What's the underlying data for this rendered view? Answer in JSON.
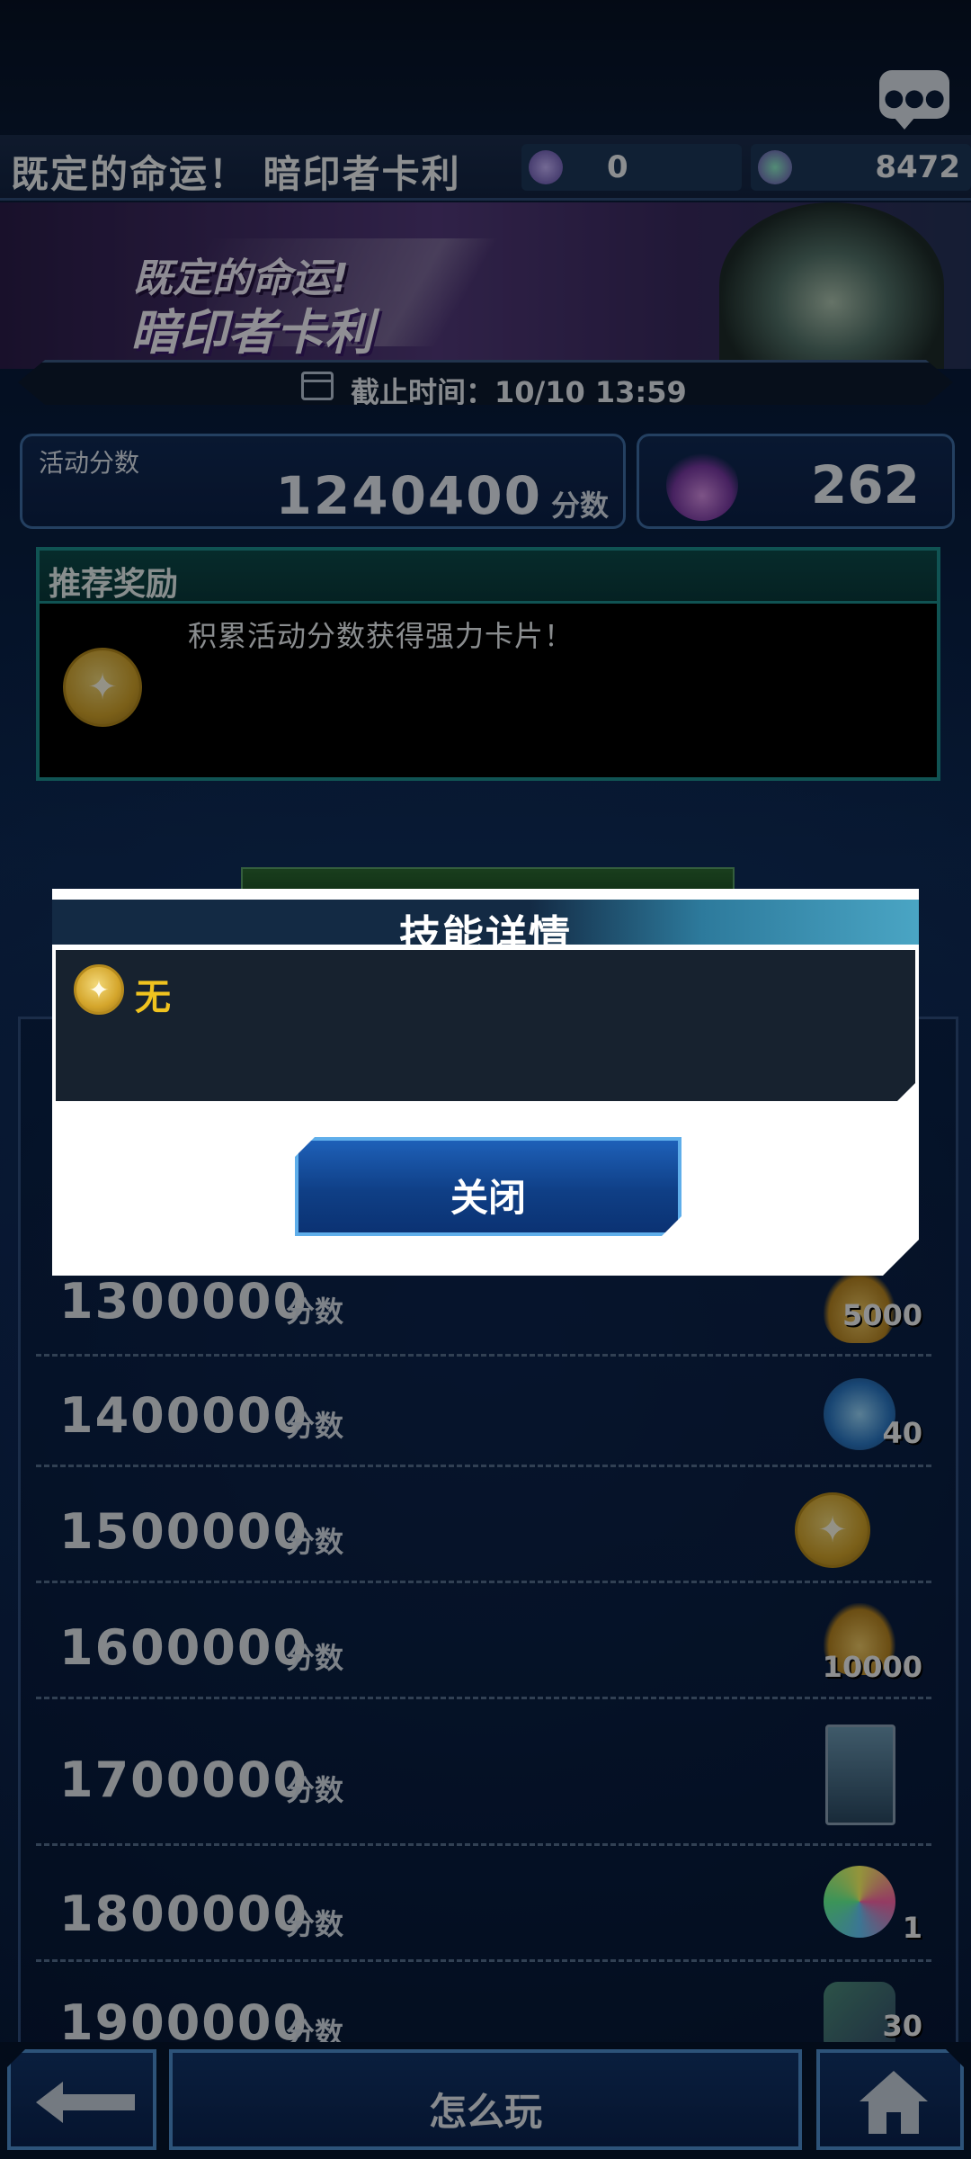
{
  "header": {
    "title": "既定的命运！ 暗印者卡利",
    "currency_a": "0",
    "currency_b": "8472"
  },
  "banner": {
    "line1": "既定的命运!",
    "line2": "暗印者卡利",
    "deadline": "截止时间：10/10 13:59"
  },
  "scores": {
    "activity_label": "活动分数",
    "activity_value": "1240400",
    "unit": "分数",
    "flame_value": "262"
  },
  "reward": {
    "title": "推荐奖励",
    "description": "积累活动分数获得强力卡片！"
  },
  "modal": {
    "title": "技能详情",
    "skill": "无",
    "close": "关闭"
  },
  "rows": [
    {
      "score": "1300000",
      "unit": "分数",
      "qty": "5000"
    },
    {
      "score": "1400000",
      "unit": "分数",
      "qty": "40"
    },
    {
      "score": "1500000",
      "unit": "分数",
      "qty": ""
    },
    {
      "score": "1600000",
      "unit": "分数",
      "qty": "10000"
    },
    {
      "score": "1700000",
      "unit": "分数",
      "qty": ""
    },
    {
      "score": "1800000",
      "unit": "分数",
      "qty": "1"
    },
    {
      "score": "1900000",
      "unit": "分数",
      "qty": "30"
    }
  ],
  "icons": {
    "row_0": "gold-coins-icon",
    "row_1": "gem-badge-icon",
    "row_2": "gold-coin-icon",
    "row_3": "gold-coins-icon",
    "row_4": "card-icon",
    "row_5": "rainbow-badge-icon",
    "row_6": "prism-icon"
  },
  "nav": {
    "how_to_play": "怎么玩"
  },
  "colors": {
    "accent_blue": "#0f3f86",
    "skill_gold": "#f0c31f",
    "reward_border": "#1c8f8f"
  }
}
